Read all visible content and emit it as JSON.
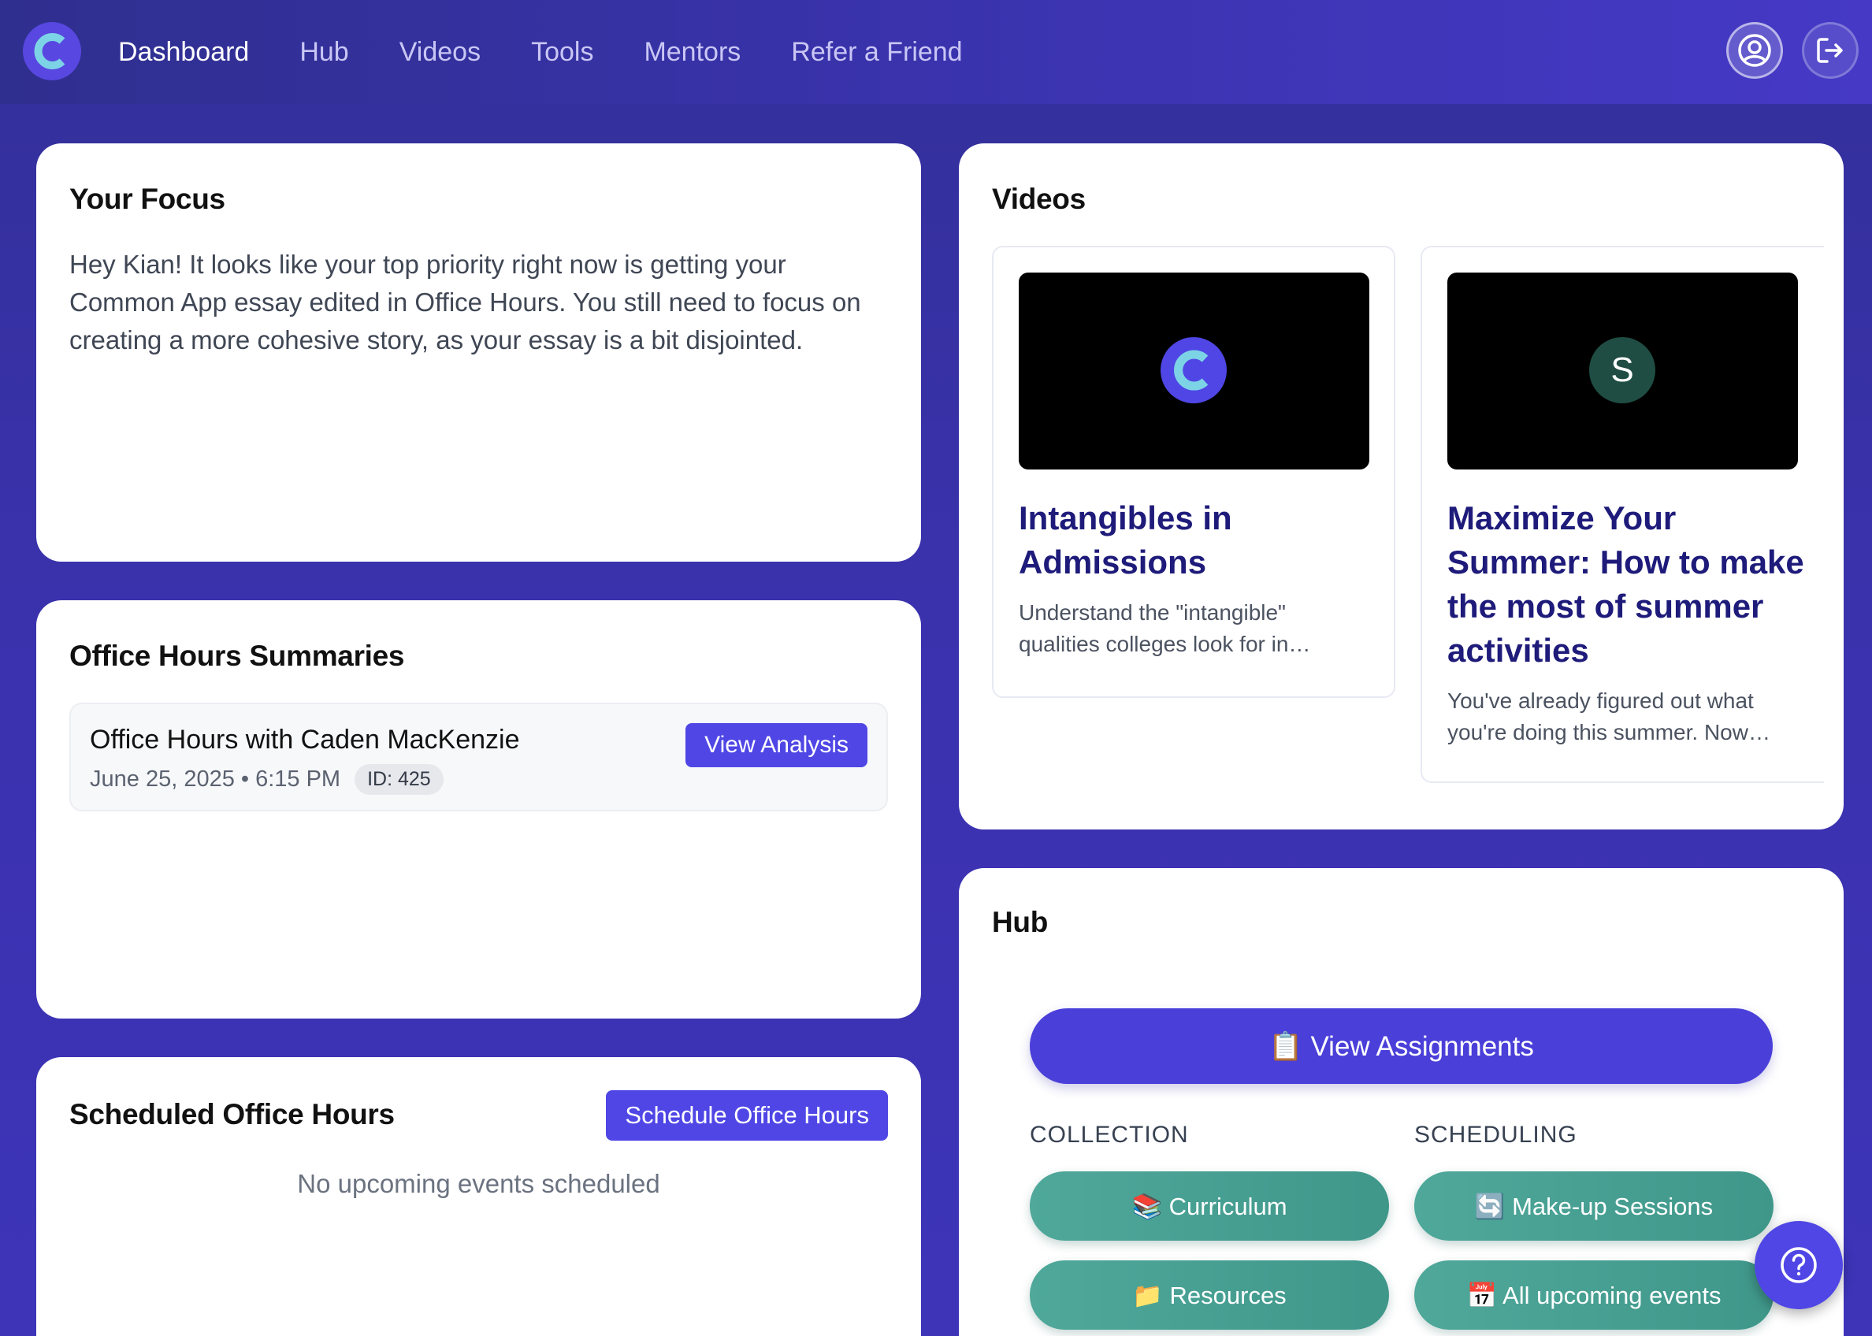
{
  "nav": {
    "logo_letter": "C",
    "items": [
      {
        "label": "Dashboard",
        "active": true
      },
      {
        "label": "Hub",
        "active": false
      },
      {
        "label": "Videos",
        "active": false
      },
      {
        "label": "Tools",
        "active": false
      },
      {
        "label": "Mentors",
        "active": false
      },
      {
        "label": "Refer a Friend",
        "active": false
      }
    ],
    "icons": [
      "user-circle-icon",
      "logout-icon"
    ]
  },
  "focus": {
    "title": "Your Focus",
    "text": "Hey Kian! It looks like your top priority right now is getting your Common App essay edited in Office Hours. You still need to focus on creating a more cohesive story, as your essay is a bit disjointed."
  },
  "office_hours_summaries": {
    "title": "Office Hours Summaries",
    "items": [
      {
        "title": "Office Hours with Caden MacKenzie",
        "date": "June 25, 2025 • 6:15 PM",
        "id": "ID: 425",
        "button": "View Analysis"
      }
    ]
  },
  "scheduled": {
    "title": "Scheduled Office Hours",
    "button": "Schedule Office Hours",
    "empty": "No upcoming events scheduled"
  },
  "videos": {
    "title": "Videos",
    "items": [
      {
        "badge": "C",
        "title": "Intangibles in Admissions",
        "desc": "Understand the \"intangible\" qualities colleges look for in…"
      },
      {
        "badge": "S",
        "title": "Maximize Your Summer: How to make the most of summer activities",
        "desc": "You've already figured out what you're doing this summer. Now…"
      }
    ]
  },
  "hub": {
    "title": "Hub",
    "assignments_button": "📋 View Assignments",
    "collection_label": "COLLECTION",
    "scheduling_label": "SCHEDULING",
    "curriculum": "📚 Curriculum",
    "makeup": "🔄 Make-up Sessions",
    "resources": "📁 Resources",
    "upcoming": "📅 All upcoming events"
  },
  "colors": {
    "brand": "#4f46e5",
    "background": "#3a33ad",
    "teal": "#4fa89a",
    "title_navy": "#1e1b7a"
  }
}
